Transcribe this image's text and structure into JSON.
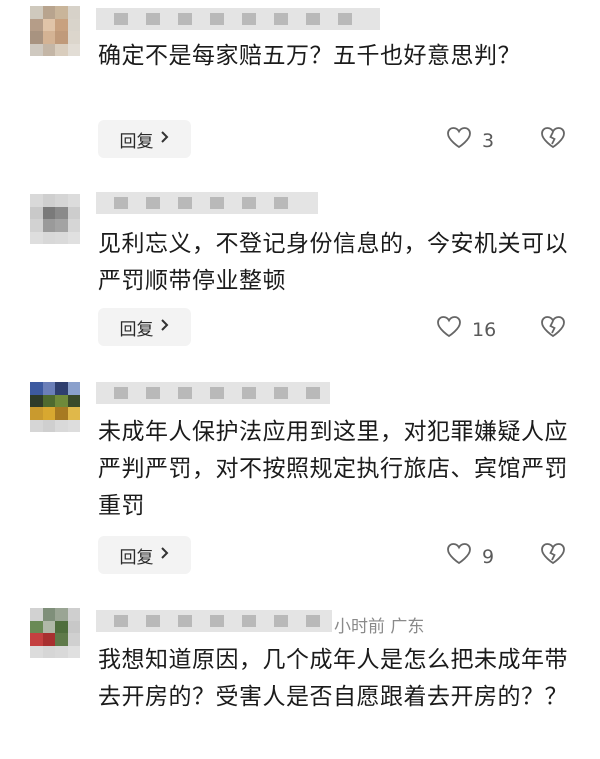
{
  "comments": [
    {
      "avatar_colors": [
        "#cfc9bd",
        "#b8a48e",
        "#c9b59a",
        "#d7d2c9",
        "#b59d88",
        "#e0c4a8",
        "#c8a17f",
        "#d9d4cb",
        "#a89380",
        "#d4b394",
        "#c09a7a",
        "#dcd6cc",
        "#cfc9c0",
        "#c4b6a6",
        "#d9cdbd",
        "#e2ddd5"
      ],
      "text": "确定不是每家赔五万？五千也好意思判？",
      "reply_label": "回复",
      "likes": "3"
    },
    {
      "avatar_colors": [
        "#d9d9d9",
        "#cfcfcf",
        "#d5d5d5",
        "#dcdcdc",
        "#c9c9c9",
        "#7a7a7a",
        "#8a8a8a",
        "#cdcdcd",
        "#d2d2d2",
        "#9a9a9a",
        "#a3a3a3",
        "#d6d6d6",
        "#dedede",
        "#d8d8d8",
        "#dadada",
        "#e0e0e0"
      ],
      "text": "见利忘义，不登记身份信息的，今安机关可以严罚顺带停业整顿",
      "reply_label": "回复",
      "likes": "16"
    },
    {
      "avatar_colors": [
        "#3d5aa0",
        "#6b7fb8",
        "#2f3f6f",
        "#8aa0cc",
        "#2e3b2a",
        "#4e6a2f",
        "#6f8a3a",
        "#3a4a2a",
        "#c99a2e",
        "#d8a830",
        "#a77a22",
        "#e0b84a",
        "#d6d6d6",
        "#cfcfcf",
        "#d9d9d9",
        "#dddddd"
      ],
      "text": "未成年人保护法应用到这里，对犯罪嫌疑人应严判严罚，对不按照规定执行旅店、宾馆严罚重罚",
      "reply_label": "回复",
      "likes": "9"
    },
    {
      "avatar_colors": [
        "#d2d2d2",
        "#7f8f7a",
        "#9aa594",
        "#cfcfcf",
        "#6a8a55",
        "#b0b8a8",
        "#4f6e3d",
        "#c8c8c8",
        "#c44040",
        "#a83030",
        "#5f7a4a",
        "#d0d0d0",
        "#dcdcdc",
        "#d6d6d6",
        "#d9d9d9",
        "#e0e0e0"
      ],
      "meta": "小时前   广东",
      "text": "我想知道原因，几个成年人是怎么把未成年带去开房的？受害人是否自愿跟着去开房的？？"
    }
  ]
}
